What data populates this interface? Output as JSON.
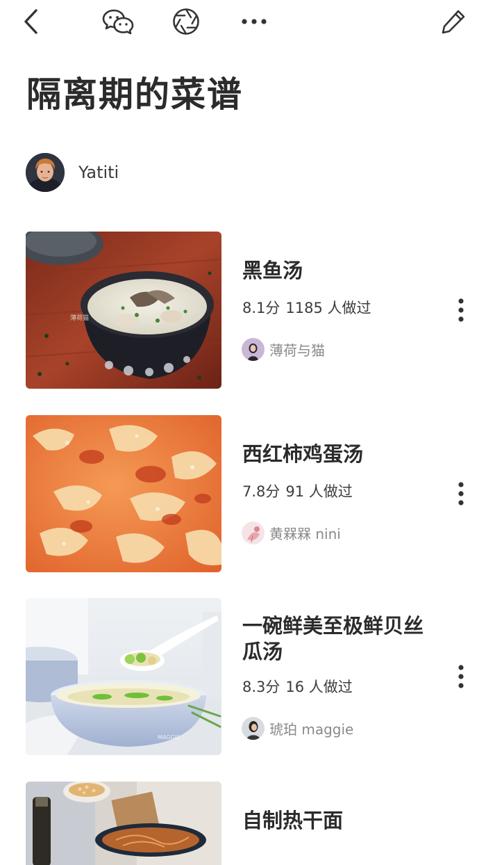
{
  "toolbar": {
    "back_icon": "chevron-left-icon",
    "wechat_icon": "wechat-icon",
    "moments_icon": "moments-shutter-icon",
    "more_icon": "more-horizontal-icon",
    "edit_icon": "pencil-icon"
  },
  "collection": {
    "title": "隔离期的菜谱",
    "author": "Yatiti"
  },
  "recipes": [
    {
      "name": "黑鱼汤",
      "score": "8.1分",
      "cooked": "1185 人做过",
      "author": "薄荷与猫"
    },
    {
      "name": "西红柿鸡蛋汤",
      "score": "7.8分",
      "cooked": "91 人做过",
      "author": "黄槑槑 nini"
    },
    {
      "name": "一碗鲜美至极鲜贝丝瓜汤",
      "score": "8.3分",
      "cooked": "16 人做过",
      "author": "琥珀 maggie"
    },
    {
      "name": "自制热干面"
    }
  ],
  "colors": {
    "text_primary": "#2b2b2b",
    "text_secondary": "#8a8a8a",
    "background": "#ffffff"
  }
}
